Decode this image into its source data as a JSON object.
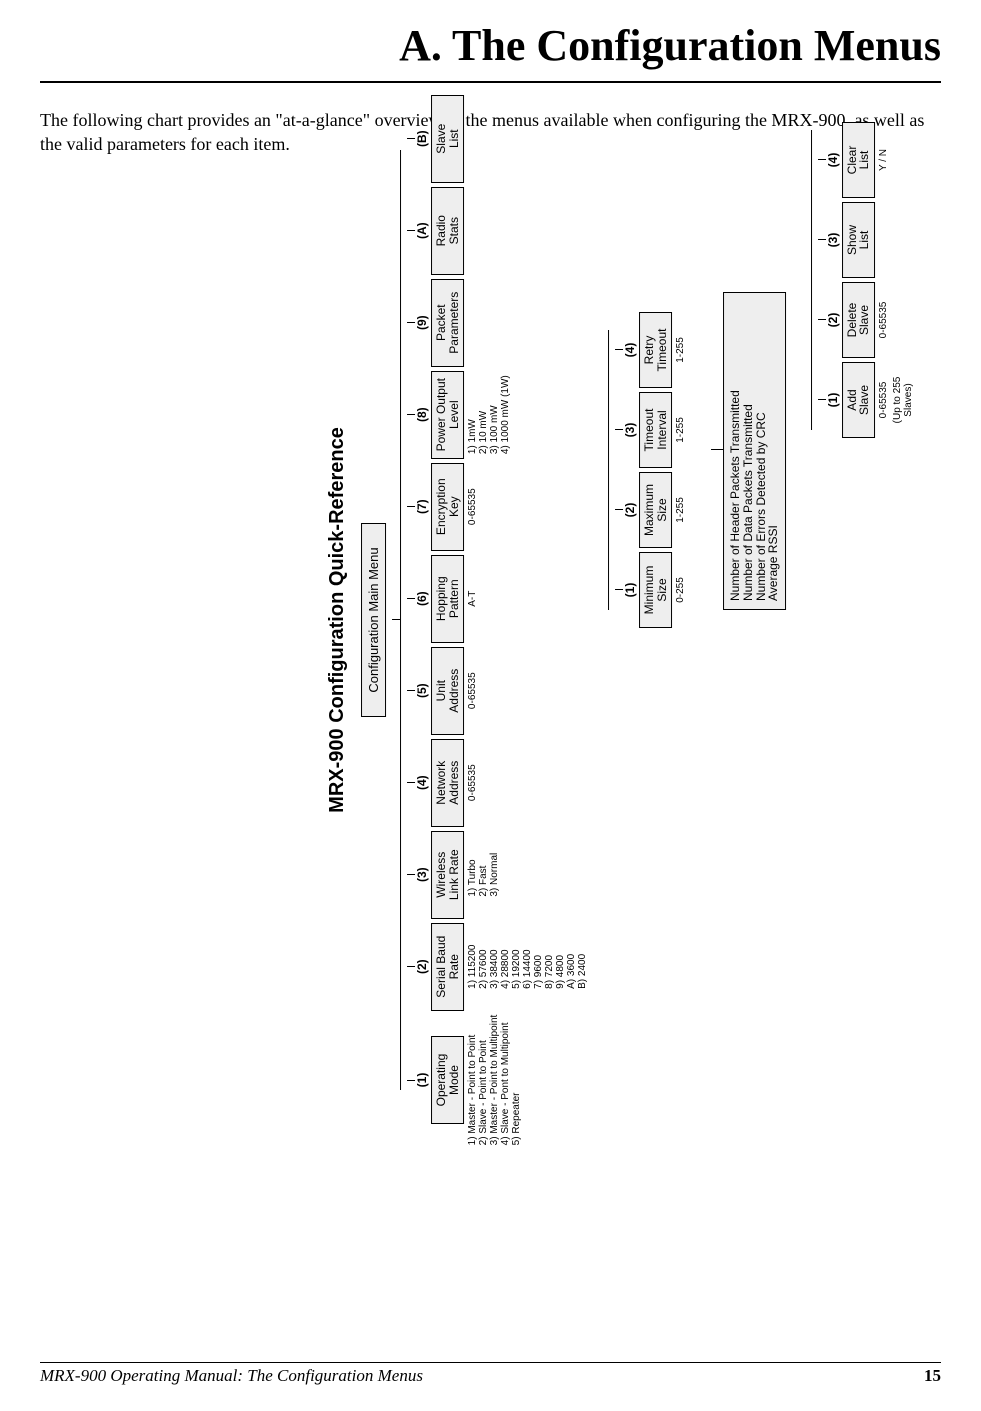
{
  "page": {
    "appendix_title": "A. The Configuration Menus",
    "intro": "The following chart provides an \"at-a-glance\" overview of the menus available when configuring the MRX-900, as well as the valid parameters for each item.",
    "footer_left": "MRX-900 Operating Manual: The Configuration Menus",
    "footer_page": "15"
  },
  "chart_data": {
    "type": "tree",
    "title": "MRX-900 Configuration Quick-Reference",
    "root": "Configuration Main Menu",
    "top_level": [
      {
        "id": "(1)",
        "label": "Operating\nMode",
        "values": "1) Master - Point to Point\n2) Slave - Point to Point\n3) Master - Point to Multipoint\n4) Slave - Pont to Multipoint\n5) Repeater"
      },
      {
        "id": "(2)",
        "label": "Serial Baud\nRate",
        "values": "1) 115200\n2) 57600\n3) 38400\n4) 28800\n5) 19200\n6) 14400\n7) 9600\n8) 7200\n9) 4800\nA) 3600\nB) 2400"
      },
      {
        "id": "(3)",
        "label": "Wireless\nLink Rate",
        "values": "1) Turbo\n2) Fast\n3) Normal"
      },
      {
        "id": "(4)",
        "label": "Network\nAddress",
        "values": "0-65535"
      },
      {
        "id": "(5)",
        "label": "Unit\nAddress",
        "values": "0-65535"
      },
      {
        "id": "(6)",
        "label": "Hopping\nPattern",
        "values": "A-T"
      },
      {
        "id": "(7)",
        "label": "Encryption\nKey",
        "values": "0-65535"
      },
      {
        "id": "(8)",
        "label": "Power Output\nLevel",
        "values": "1) 1mW\n2) 10 mW\n3) 100 mW\n4) 1000 mW (1W)"
      },
      {
        "id": "(9)",
        "label": "Packet\nParameters",
        "values": ""
      },
      {
        "id": "(A)",
        "label": "Radio\nStats",
        "values": ""
      },
      {
        "id": "(B)",
        "label": "Slave\nList",
        "values": ""
      }
    ],
    "packet_params_children": [
      {
        "id": "(1)",
        "label": "Minimum\nSize",
        "values": "0-255"
      },
      {
        "id": "(2)",
        "label": "Maximum\nSize",
        "values": "1-255"
      },
      {
        "id": "(3)",
        "label": "Timeout\nInterval",
        "values": "1-255"
      },
      {
        "id": "(4)",
        "label": "Retry\nTimeout",
        "values": "1-255"
      }
    ],
    "radio_stats_child": {
      "lines": [
        "Number of Header Packets Transmitted",
        "Number of Data Packets Transmitted",
        "Number of Errors Detected by CRC",
        "Average RSSI"
      ]
    },
    "slave_list_children": [
      {
        "id": "(1)",
        "label": "Add\nSlave",
        "values": "0-65535",
        "note": "(Up to 255\nSlaves)"
      },
      {
        "id": "(2)",
        "label": "Delete\nSlave",
        "values": "0-65535"
      },
      {
        "id": "(3)",
        "label": "Show\nList",
        "values": ""
      },
      {
        "id": "(4)",
        "label": "Clear\nList",
        "values": "Y / N"
      }
    ]
  }
}
